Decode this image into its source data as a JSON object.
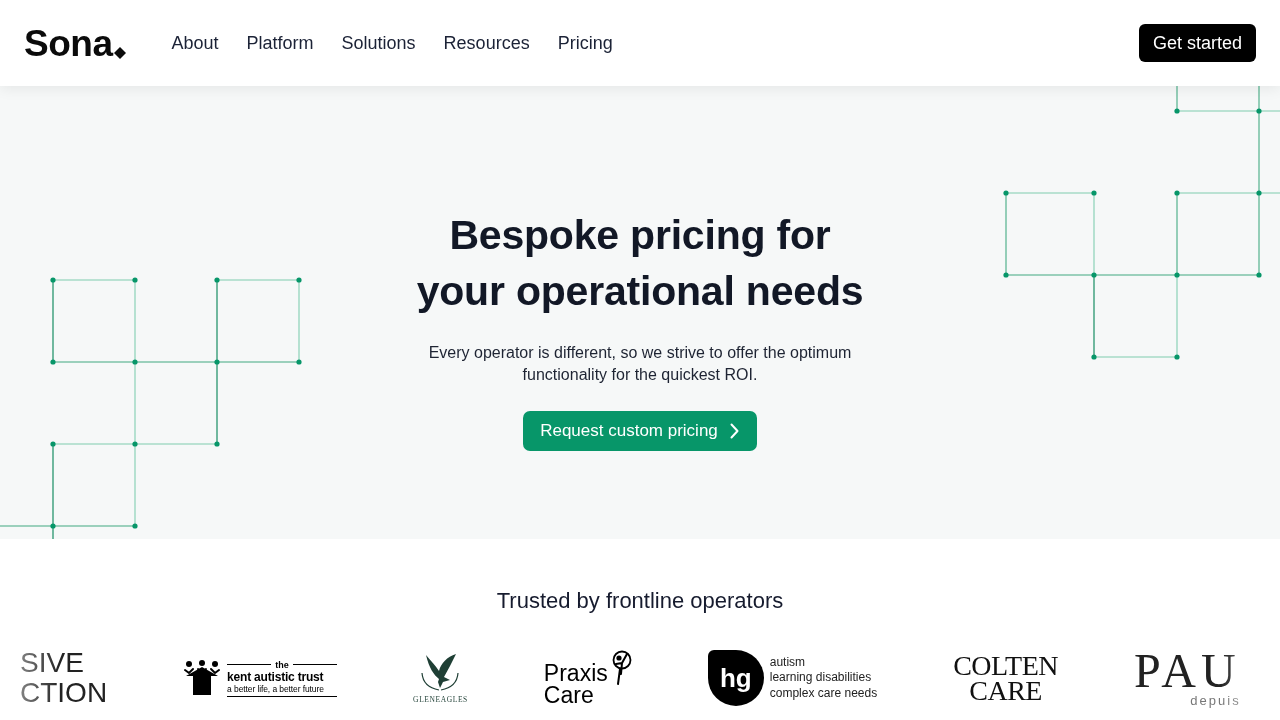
{
  "header": {
    "logo": "Sona",
    "nav": [
      "About",
      "Platform",
      "Solutions",
      "Resources",
      "Pricing"
    ],
    "cta": "Get started"
  },
  "hero": {
    "title_lines": [
      "Bespoke pricing for",
      "your operational needs"
    ],
    "subtitle": "Every operator is different, so we strive to offer the optimum functionality for the quickest ROI.",
    "button": "Request custom pricing"
  },
  "trusted": {
    "heading": "Trusted by frontline operators",
    "logos": [
      {
        "kind": "stacked",
        "lines": [
          "SIVE",
          "CTION"
        ]
      },
      {
        "kind": "house",
        "top": "the",
        "name": "kent autistic trust",
        "tagline": "a better life, a better future"
      },
      {
        "kind": "eagle",
        "caption": "GLENEAGLES"
      },
      {
        "kind": "figure",
        "lines": [
          "Praxis",
          "Care"
        ]
      },
      {
        "kind": "monogram",
        "mark": "hg",
        "lines": [
          "autism",
          "learning disabilities",
          "complex care needs"
        ]
      },
      {
        "kind": "serif",
        "lines": [
          "COLTEN",
          "CARE"
        ]
      },
      {
        "kind": "serif-large",
        "name": "PAU",
        "tagline": "depuis"
      }
    ]
  }
}
